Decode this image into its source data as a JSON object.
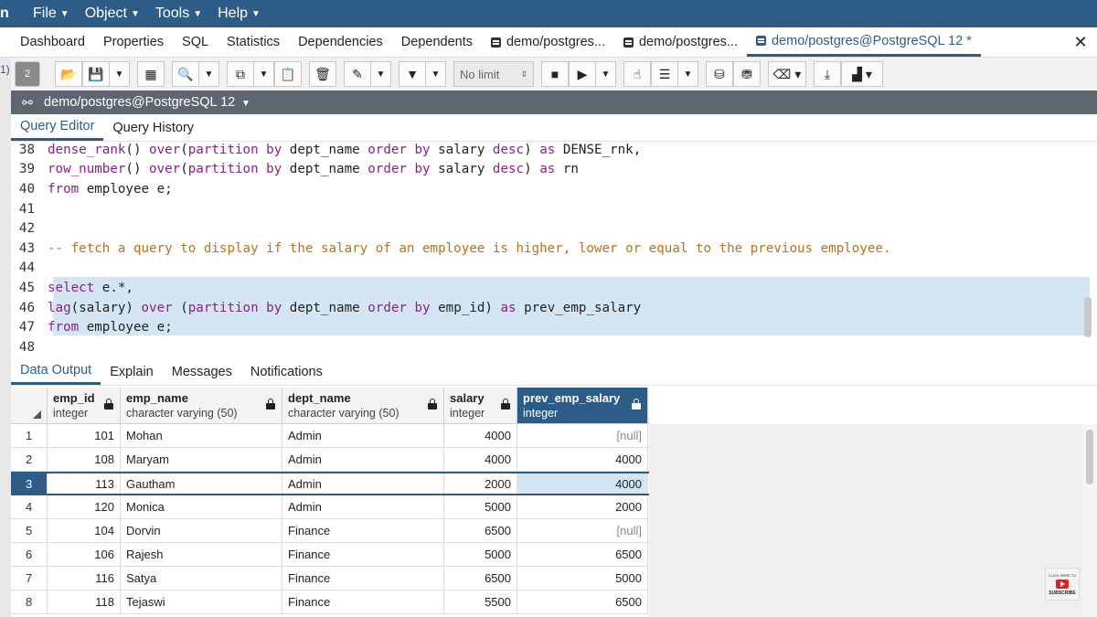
{
  "menubar": {
    "logo": "n",
    "items": [
      {
        "label": "File"
      },
      {
        "label": "Object"
      },
      {
        "label": "Tools"
      },
      {
        "label": "Help"
      }
    ]
  },
  "tabs": [
    {
      "label": "Dashboard",
      "icon": null,
      "active": false
    },
    {
      "label": "Properties",
      "icon": null,
      "active": false
    },
    {
      "label": "SQL",
      "icon": null,
      "active": false
    },
    {
      "label": "Statistics",
      "icon": null,
      "active": false
    },
    {
      "label": "Dependencies",
      "icon": null,
      "active": false
    },
    {
      "label": "Dependents",
      "icon": null,
      "active": false
    },
    {
      "label": "demo/postgres...",
      "icon": "query-tool-icon",
      "active": false
    },
    {
      "label": "demo/postgres...",
      "icon": "query-tool-icon",
      "active": false
    },
    {
      "label": "demo/postgres@PostgreSQL 12 *",
      "icon": "query-tool-icon",
      "active": true
    }
  ],
  "left_strip_label": "1)",
  "toolbar": {
    "badge": "2",
    "row_limit": "No limit"
  },
  "connection": {
    "label": "demo/postgres@PostgreSQL 12"
  },
  "editor_tabs": [
    {
      "label": "Query Editor",
      "active": true
    },
    {
      "label": "Query History",
      "active": false
    }
  ],
  "code_lines": [
    {
      "num": "38",
      "parts": [
        [
          "fn",
          "dense_rank"
        ],
        [
          "",
          "() "
        ],
        [
          "kw",
          "over"
        ],
        [
          "",
          "("
        ],
        [
          "kw",
          "partition by"
        ],
        [
          "",
          " dept_name "
        ],
        [
          "kw",
          "order by"
        ],
        [
          "",
          " salary "
        ],
        [
          "kw",
          "desc"
        ],
        [
          "",
          ") "
        ],
        [
          "kw",
          "as"
        ],
        [
          "",
          " DENSE_rnk,"
        ]
      ]
    },
    {
      "num": "39",
      "parts": [
        [
          "fn",
          "row_number"
        ],
        [
          "",
          "() "
        ],
        [
          "kw",
          "over"
        ],
        [
          "",
          "("
        ],
        [
          "kw",
          "partition by"
        ],
        [
          "",
          " dept_name "
        ],
        [
          "kw",
          "order by"
        ],
        [
          "",
          " salary "
        ],
        [
          "kw",
          "desc"
        ],
        [
          "",
          ") "
        ],
        [
          "kw",
          "as"
        ],
        [
          "",
          " rn"
        ]
      ]
    },
    {
      "num": "40",
      "parts": [
        [
          "kw",
          "from"
        ],
        [
          "",
          " employee e;"
        ]
      ]
    },
    {
      "num": "41",
      "parts": []
    },
    {
      "num": "42",
      "parts": []
    },
    {
      "num": "43",
      "parts": [
        [
          "cmt",
          "-- fetch a query to display if the salary of an employee is higher, lower or equal to the previous employee."
        ]
      ]
    },
    {
      "num": "44",
      "parts": []
    },
    {
      "num": "45",
      "parts": [
        [
          "kw",
          "select"
        ],
        [
          "",
          " e.*,"
        ]
      ]
    },
    {
      "num": "46",
      "parts": [
        [
          "fn",
          "lag"
        ],
        [
          "",
          "(salary) "
        ],
        [
          "kw",
          "over"
        ],
        [
          "",
          " ("
        ],
        [
          "kw",
          "partition by"
        ],
        [
          "",
          " dept_name "
        ],
        [
          "kw",
          "order by"
        ],
        [
          "",
          " emp_id) "
        ],
        [
          "kw",
          "as"
        ],
        [
          "",
          " prev_emp_salary"
        ]
      ]
    },
    {
      "num": "47",
      "parts": [
        [
          "kw",
          "from"
        ],
        [
          "",
          " employee e;"
        ]
      ]
    },
    {
      "num": "48",
      "parts": []
    }
  ],
  "output_tabs": [
    {
      "label": "Data Output",
      "active": true
    },
    {
      "label": "Explain",
      "active": false
    },
    {
      "label": "Messages",
      "active": false
    },
    {
      "label": "Notifications",
      "active": false
    }
  ],
  "grid": {
    "columns": [
      {
        "name": "emp_id",
        "type": "integer"
      },
      {
        "name": "emp_name",
        "type": "character varying (50)"
      },
      {
        "name": "dept_name",
        "type": "character varying (50)"
      },
      {
        "name": "salary",
        "type": "integer"
      },
      {
        "name": "prev_emp_salary",
        "type": "integer"
      }
    ],
    "selected_column": 4,
    "active_row": 3,
    "rows": [
      {
        "n": "1",
        "emp_id": "101",
        "emp_name": "Mohan",
        "dept_name": "Admin",
        "salary": "4000",
        "prev": "[null]"
      },
      {
        "n": "2",
        "emp_id": "108",
        "emp_name": "Maryam",
        "dept_name": "Admin",
        "salary": "4000",
        "prev": "4000"
      },
      {
        "n": "3",
        "emp_id": "113",
        "emp_name": "Gautham",
        "dept_name": "Admin",
        "salary": "2000",
        "prev": "4000"
      },
      {
        "n": "4",
        "emp_id": "120",
        "emp_name": "Monica",
        "dept_name": "Admin",
        "salary": "5000",
        "prev": "2000"
      },
      {
        "n": "5",
        "emp_id": "104",
        "emp_name": "Dorvin",
        "dept_name": "Finance",
        "salary": "6500",
        "prev": "[null]"
      },
      {
        "n": "6",
        "emp_id": "106",
        "emp_name": "Rajesh",
        "dept_name": "Finance",
        "salary": "5000",
        "prev": "6500"
      },
      {
        "n": "7",
        "emp_id": "116",
        "emp_name": "Satya",
        "dept_name": "Finance",
        "salary": "6500",
        "prev": "5000"
      },
      {
        "n": "8",
        "emp_id": "118",
        "emp_name": "Tejaswi",
        "dept_name": "Finance",
        "salary": "5500",
        "prev": "6500"
      }
    ]
  },
  "subscribe_badge": {
    "top_text": "CLICK HERE TO",
    "label": "SUBSCRIBE"
  },
  "colors": {
    "accent": "#2d5d87",
    "selection": "#d4e6f3",
    "keyword": "#8b1e8b",
    "comment": "#b5741c"
  }
}
